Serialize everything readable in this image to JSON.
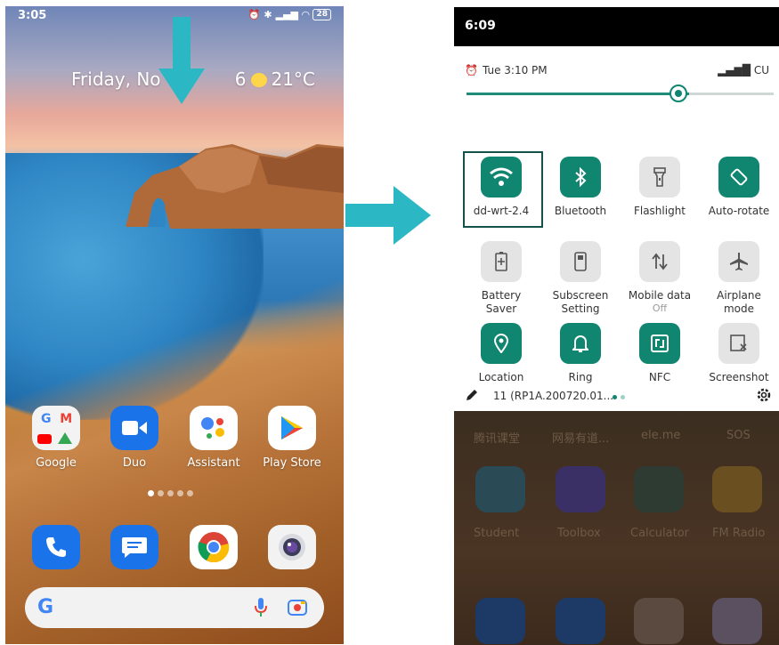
{
  "left_phone": {
    "status_time": "3:05",
    "battery": "28",
    "date_weather": "Friday, No",
    "date_tail": "6",
    "temperature": "21°C",
    "apps_row1": [
      "Google",
      "Duo",
      "Assistant",
      "Play Store"
    ],
    "dock": [
      "phone-icon",
      "messages-icon",
      "chrome-icon",
      "camera-icon"
    ],
    "page_dots": 5,
    "search_logo": "G"
  },
  "right_phone": {
    "status_time": "6:09",
    "shade_time": "Tue 3:10 PM",
    "carrier": "CU",
    "brightness": 0.725,
    "tiles": [
      {
        "label": "dd-wrt-2.4",
        "state": "on"
      },
      {
        "label": "Bluetooth",
        "state": "on"
      },
      {
        "label": "Flashlight",
        "state": "off"
      },
      {
        "label": "Auto-rotate",
        "state": "on"
      },
      {
        "label": "Battery",
        "label2": "Saver",
        "state": "off"
      },
      {
        "label": "Subscreen",
        "label2": "Setting",
        "state": "off"
      },
      {
        "label": "Mobile data",
        "sub": "Off",
        "state": "off"
      },
      {
        "label": "Airplane",
        "label2": "mode",
        "state": "off"
      },
      {
        "label": "Location",
        "state": "on"
      },
      {
        "label": "Ring",
        "state": "on"
      },
      {
        "label": "NFC",
        "state": "on"
      },
      {
        "label": "Screenshot",
        "state": "off"
      }
    ],
    "build": "11 (RP1A.200720.01...",
    "dimmed_top_labels": [
      "腾讯课堂",
      "网易有道...",
      "ele.me",
      "SOS"
    ],
    "dimmed_apps": [
      "Student",
      "Toolbox",
      "Calculator",
      "FM Radio"
    ]
  },
  "colors": {
    "accent": "#10856f",
    "arrow": "#2bb8c4"
  }
}
